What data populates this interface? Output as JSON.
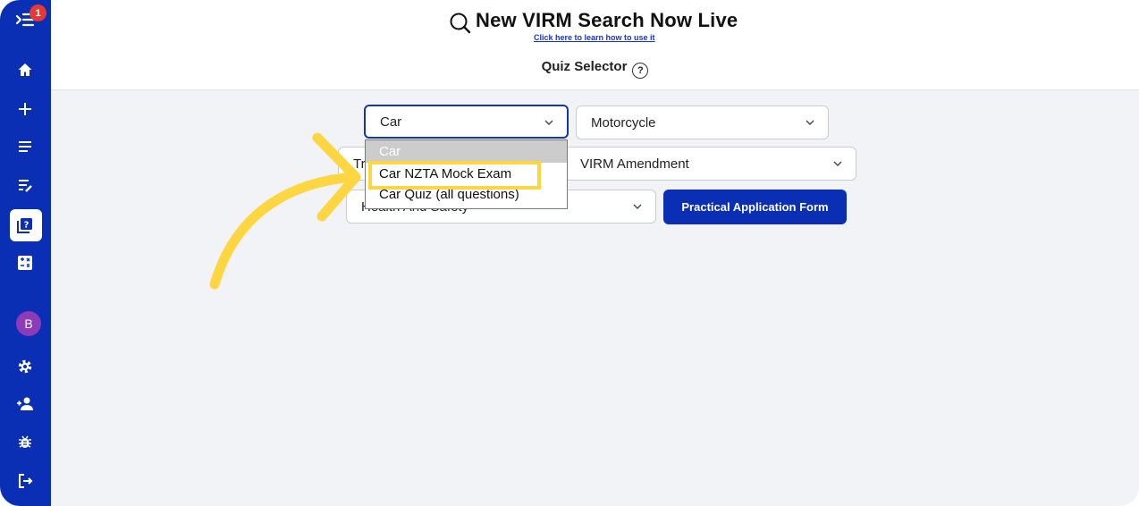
{
  "sidebar": {
    "badge_count": "1",
    "avatar_initial": "B",
    "icons": [
      "menu-icon",
      "home-icon",
      "plus-icon",
      "list-icon",
      "playlist-edit-icon",
      "quiz-icon",
      "calculator-icon",
      "settings-icon",
      "add-user-icon",
      "bug-icon",
      "logout-icon"
    ]
  },
  "header": {
    "banner_title": "New VIRM Search Now Live",
    "banner_link": "Click here to learn how to use it",
    "quiz_selector_label": "Quiz Selector",
    "help_icon": "?"
  },
  "filters": {
    "car_select": "Car",
    "motorcycle_select": "Motorcycle",
    "second_row_left_partial": "Tr",
    "virm_select": "VIRM Amendment",
    "health_select": "Health And Safety",
    "practical_button": "Practical Application Form"
  },
  "dropdown": {
    "options": [
      "Car",
      "Car NZTA Mock Exam",
      "Car Quiz (all questions)"
    ],
    "selected_index": 0
  },
  "annotation": {
    "highlight_color": "#fdd642",
    "arrow_color": "#fdd642"
  }
}
